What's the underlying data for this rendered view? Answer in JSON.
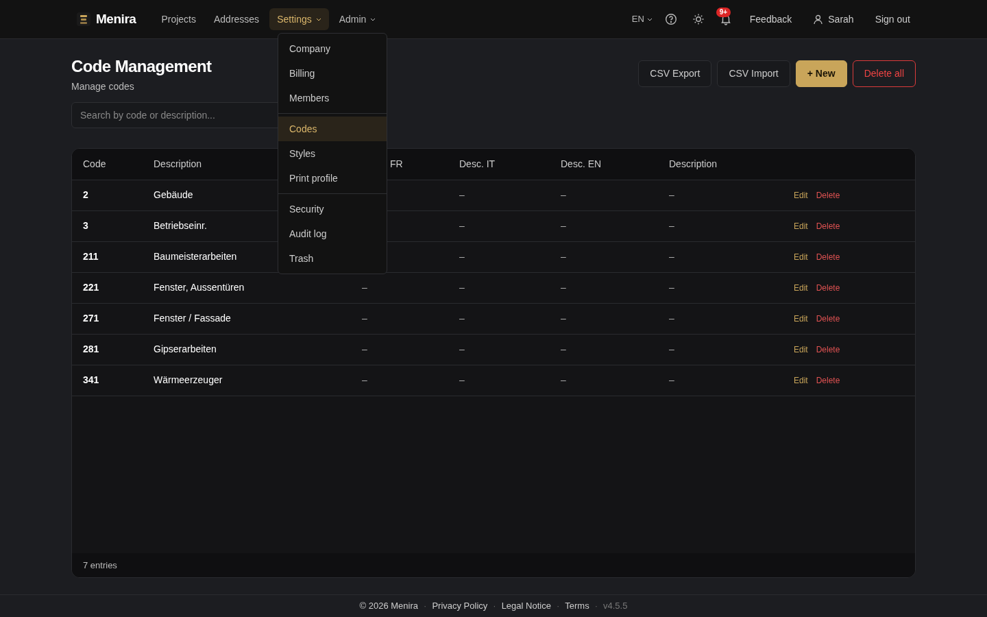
{
  "brand": {
    "name": "Menira"
  },
  "nav": [
    {
      "label": "Projects",
      "selected": false,
      "dropdown": false
    },
    {
      "label": "Addresses",
      "selected": false,
      "dropdown": false
    },
    {
      "label": "Settings",
      "selected": true,
      "dropdown": true
    },
    {
      "label": "Admin",
      "selected": false,
      "dropdown": true
    }
  ],
  "header_right": {
    "language": "EN",
    "notification_badge": "9+",
    "feedback": "Feedback",
    "user": "Sarah",
    "sign_out": "Sign out"
  },
  "settings_menu": {
    "groups": [
      [
        {
          "label": "Company",
          "selected": false
        },
        {
          "label": "Billing",
          "selected": false
        },
        {
          "label": "Members",
          "selected": false
        }
      ],
      [
        {
          "label": "Codes",
          "selected": true
        },
        {
          "label": "Styles",
          "selected": false
        },
        {
          "label": "Print profile",
          "selected": false
        }
      ],
      [
        {
          "label": "Security",
          "selected": false
        },
        {
          "label": "Audit log",
          "selected": false
        },
        {
          "label": "Trash",
          "selected": false
        }
      ]
    ]
  },
  "page": {
    "title": "Code Management",
    "subtitle": "Manage codes"
  },
  "actions": [
    {
      "label": "CSV Export",
      "kind": "outline"
    },
    {
      "label": "CSV Import",
      "kind": "outline"
    },
    {
      "label": "+ New",
      "kind": "primary"
    },
    {
      "label": "Delete all",
      "kind": "danger"
    }
  ],
  "search": {
    "placeholder": "Search by code or description..."
  },
  "table": {
    "columns": [
      "Code",
      "Description",
      "FR",
      "Desc. IT",
      "Desc. EN",
      "Description"
    ],
    "rows": [
      {
        "code": "2",
        "description": "Gebäude",
        "it": "–",
        "en": "–",
        "description_2": "–",
        "edit": "Edit",
        "delete": "Delete"
      },
      {
        "code": "3",
        "description": "Betriebseinr.",
        "it": "–",
        "en": "–",
        "description_2": "–",
        "edit": "Edit",
        "delete": "Delete"
      },
      {
        "code": "211",
        "description": "Baumeisterarbeiten",
        "it": "–",
        "en": "–",
        "description_2": "–",
        "edit": "Edit",
        "delete": "Delete"
      },
      {
        "code": "221",
        "description": "Fenster, Aussentüren",
        "fr": "–",
        "it": "–",
        "en": "–",
        "description_2": "–",
        "edit": "Edit",
        "delete": "Delete"
      },
      {
        "code": "271",
        "description": "Fenster / Fassade",
        "fr": "–",
        "it": "–",
        "en": "–",
        "description_2": "–",
        "edit": "Edit",
        "delete": "Delete"
      },
      {
        "code": "281",
        "description": "Gipserarbeiten",
        "fr": "–",
        "it": "–",
        "en": "–",
        "description_2": "–",
        "edit": "Edit",
        "delete": "Delete"
      },
      {
        "code": "341",
        "description": "Wärmeerzeuger",
        "fr": "–",
        "it": "–",
        "en": "–",
        "description_2": "–",
        "edit": "Edit",
        "delete": "Delete"
      }
    ],
    "footer": "7 entries"
  },
  "footer": {
    "items": [
      "© 2026 Menira",
      "Privacy Policy",
      "Legal Notice",
      "Terms"
    ],
    "separator": "·",
    "version": "v4.5.5"
  }
}
